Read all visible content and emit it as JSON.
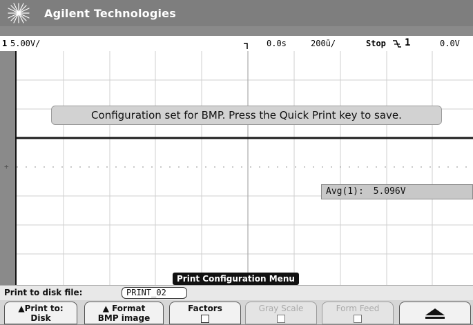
{
  "header": {
    "brand": "Agilent Technologies"
  },
  "status": {
    "channel": "1",
    "volts_div": "5.00V/",
    "time_offset": "0.0s",
    "time_div": "200ū/",
    "run_state": "Stop",
    "trigger_channel": "1",
    "trigger_level": "0.0V"
  },
  "display": {
    "message": "Configuration set for BMP. Press the Quick Print key to save.",
    "measurement_label": "Avg(1):",
    "measurement_value": "5.096V",
    "menu_title": "Print Configuration Menu"
  },
  "filebar": {
    "label": "Print to disk file:",
    "filename": "PRINT_02"
  },
  "softkeys": [
    {
      "line1": "▲Print to:",
      "line2": "Disk",
      "enabled": true
    },
    {
      "line1": "▲ Format",
      "line2": "BMP image",
      "enabled": true
    },
    {
      "line1": "Factors",
      "enabled": true
    },
    {
      "line1": "Gray Scale",
      "enabled": false
    },
    {
      "line1": "Form Feed",
      "enabled": false
    },
    {
      "icon": "up-arrow-icon",
      "enabled": true
    }
  ]
}
